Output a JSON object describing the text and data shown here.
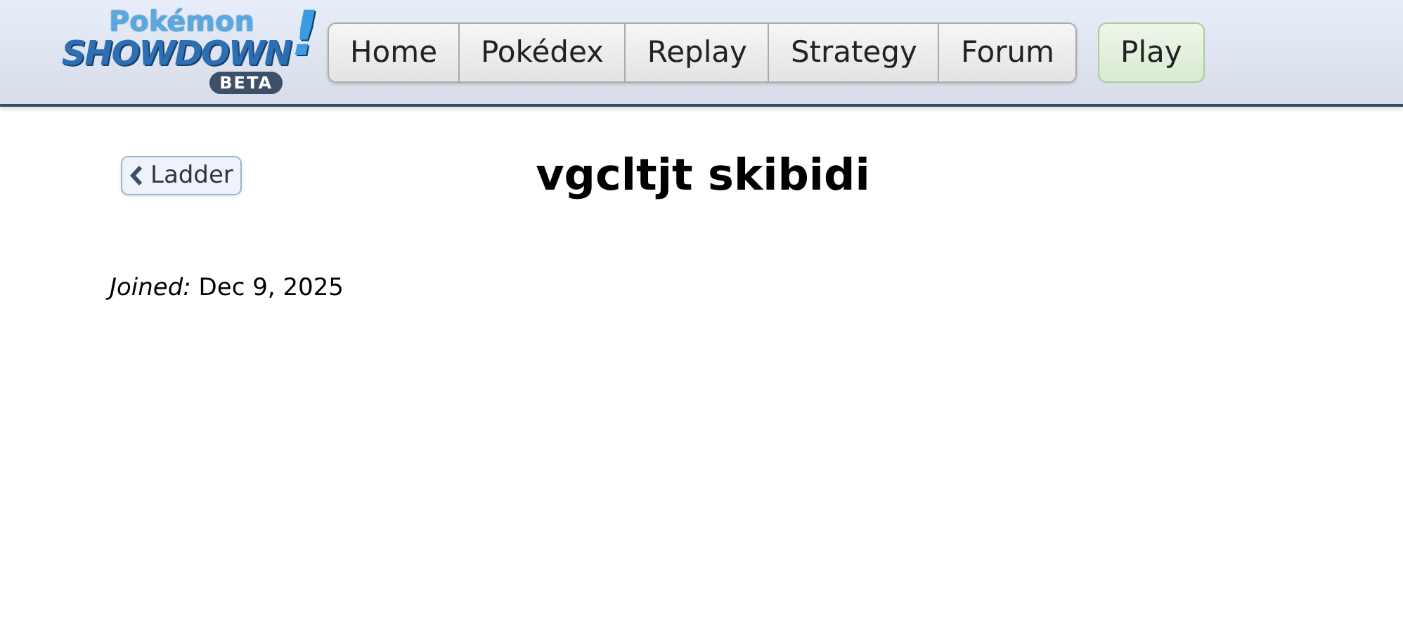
{
  "logo": {
    "top": "Pokémon",
    "main": "SHOWDOWN",
    "mark": "!",
    "badge": "BETA"
  },
  "nav": [
    {
      "label": "Home"
    },
    {
      "label": "Pokédex"
    },
    {
      "label": "Replay"
    },
    {
      "label": "Strategy"
    },
    {
      "label": "Forum"
    }
  ],
  "play_button": {
    "label": "Play"
  },
  "back_button": {
    "label": "Ladder"
  },
  "title": "vgcltjt skibidi",
  "joined": "*Joined:* Dec 9, 2025"
}
